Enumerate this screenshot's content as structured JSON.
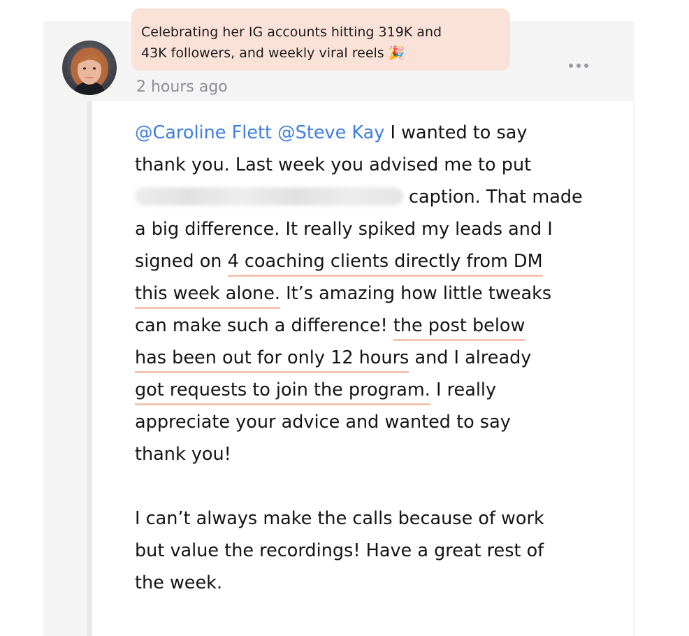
{
  "banner": {
    "line1": "Celebrating her IG accounts hitting 319K and",
    "line2": "43K followers, and weekly viral reels 🎉"
  },
  "post": {
    "timestamp": "2 hours ago",
    "mentions": [
      "@Caroline Flett",
      "@Steve Kay"
    ],
    "lines": {
      "l1_rest": " I wanted to say",
      "l2": "thank you. Last week you advised me to put",
      "l3_rest": "caption. That made",
      "l4": "a big difference. It really spiked my leads and I",
      "l5_pre": "signed on ",
      "l5_hl": "4 coaching clients directly from DM",
      "l6_hl": "this week alone.",
      "l6_rest": " It’s amazing how little tweaks",
      "l7_pre": "can make such a difference! ",
      "l7_hl": "the post below",
      "l8_hl": "has been out for only 12 hours",
      "l8_rest": " and I already",
      "l9_hl": "got requests to join the program.",
      "l9_rest": " I really",
      "l10": "appreciate your advice and wanted to say",
      "l11": "thank you!",
      "l12": "I can’t always make the calls because of work",
      "l13": "but value the recordings! Have a great rest of",
      "l14": "the week."
    }
  },
  "colors": {
    "banner_bg": "#fbe2d8",
    "mention": "#3e7ee0",
    "highlight_underline": "#f3c4b2",
    "timestamp": "#8e8e93"
  },
  "icons": {
    "more": "more-horizontal-icon",
    "avatar": "user-avatar"
  }
}
